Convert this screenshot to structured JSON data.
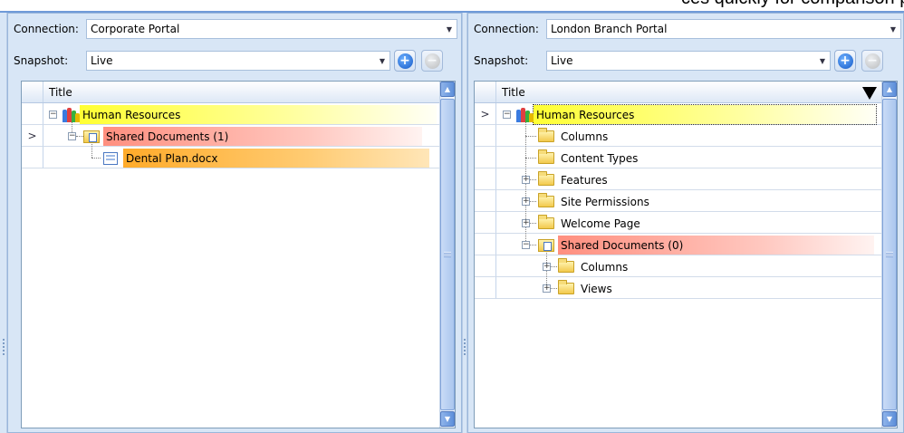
{
  "header_fragment": "ces quickly for comparison purposes",
  "colors": {
    "pane_bg": "#d8e6f6",
    "site_highlight": "#ffff33",
    "list_highlight": "#ff8f7f",
    "file_highlight": "#ffab2a",
    "accent": "#1359c7"
  },
  "left": {
    "connection_label": "Connection:",
    "connection_value": "Corporate Portal",
    "snapshot_label": "Snapshot:",
    "snapshot_value": "Live",
    "add_icon": "plus-circle-icon",
    "remove_icon": "minus-circle-icon",
    "grid": {
      "column_title": "Title",
      "rows": [
        {
          "label": "Human Resources",
          "icon": "site-icon",
          "highlight": "yellow",
          "indicator": ""
        },
        {
          "label": "Shared Documents (1)",
          "icon": "document-library-icon",
          "highlight": "red",
          "indicator": ">"
        },
        {
          "label": "Dental Plan.docx",
          "icon": "file-icon",
          "highlight": "orange",
          "indicator": ""
        }
      ]
    }
  },
  "right": {
    "connection_label": "Connection:",
    "connection_value": "London Branch Portal",
    "snapshot_label": "Snapshot:",
    "snapshot_value": "Live",
    "add_icon": "plus-circle-icon",
    "remove_icon": "minus-circle-icon",
    "grid": {
      "column_title": "Title",
      "rows": [
        {
          "label": "Human Resources",
          "icon": "site-icon",
          "highlight": "yellow",
          "indicator": ">"
        },
        {
          "label": "Columns",
          "icon": "folder-icon",
          "highlight": "none",
          "indicator": ""
        },
        {
          "label": "Content Types",
          "icon": "folder-icon",
          "highlight": "none",
          "indicator": ""
        },
        {
          "label": "Features",
          "icon": "folder-icon",
          "highlight": "none",
          "indicator": ""
        },
        {
          "label": "Site Permissions",
          "icon": "folder-icon",
          "highlight": "none",
          "indicator": ""
        },
        {
          "label": "Welcome Page",
          "icon": "folder-icon",
          "highlight": "none",
          "indicator": ""
        },
        {
          "label": "Shared Documents (0)",
          "icon": "document-library-icon",
          "highlight": "red",
          "indicator": ""
        },
        {
          "label": "Columns",
          "icon": "folder-icon",
          "highlight": "none",
          "indicator": ""
        },
        {
          "label": "Views",
          "icon": "folder-icon",
          "highlight": "none",
          "indicator": ""
        }
      ]
    }
  }
}
